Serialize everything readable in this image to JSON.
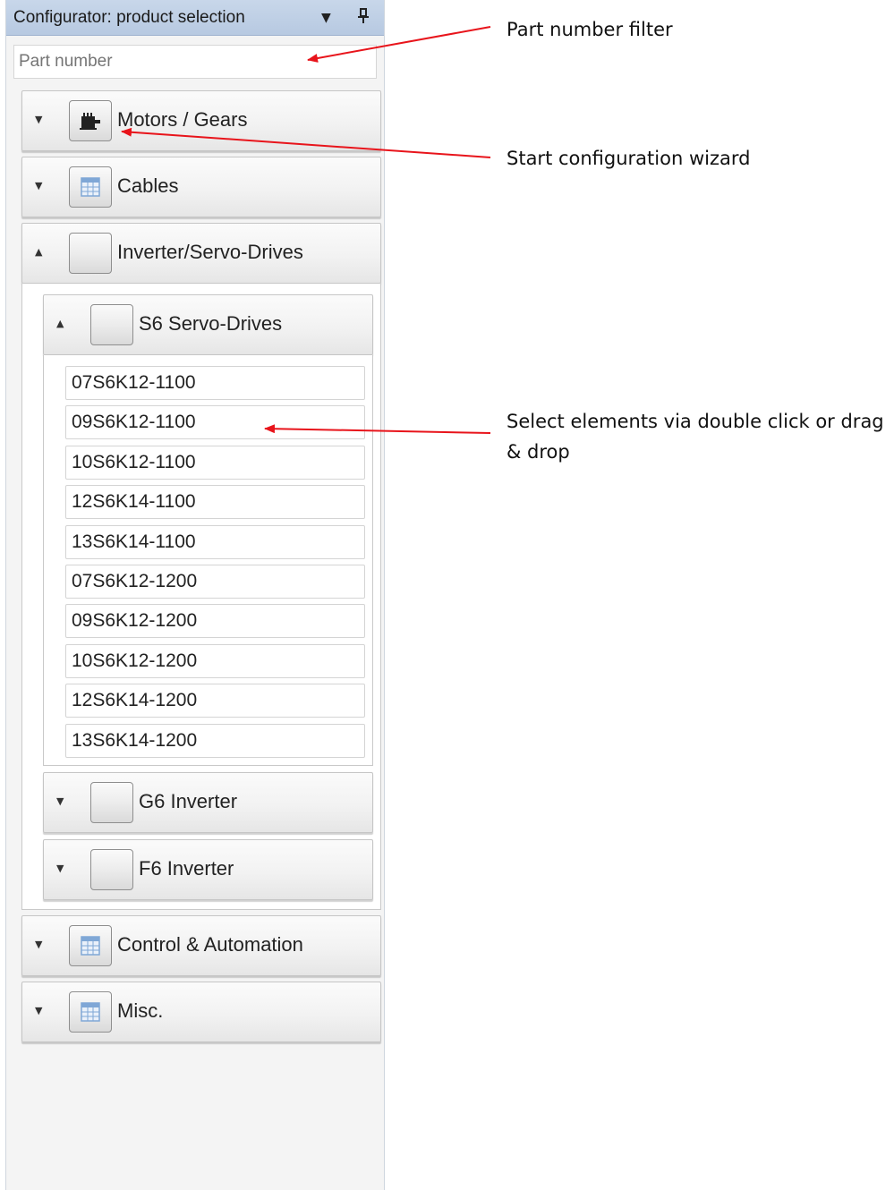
{
  "panel": {
    "title": "Configurator: product selection",
    "dropdown_icon": "dropdown-arrow-icon",
    "pin_icon": "pin-icon",
    "filter_placeholder": "Part number"
  },
  "tree": {
    "groups": [
      {
        "label": "Motors / Gears",
        "icon": "motor-icon",
        "expanded": false
      },
      {
        "label": "Cables",
        "icon": "table-icon",
        "expanded": false
      },
      {
        "label": "Inverter/Servo-Drives",
        "icon": "blank-icon",
        "expanded": true,
        "subgroups": [
          {
            "label": "S6 Servo-Drives",
            "icon": "blank-icon",
            "expanded": true,
            "items": [
              "07S6K12-1100",
              "09S6K12-1100",
              "10S6K12-1100",
              "12S6K14-1100",
              "13S6K14-1100",
              "07S6K12-1200",
              "09S6K12-1200",
              "10S6K12-1200",
              "12S6K14-1200",
              "13S6K14-1200"
            ]
          },
          {
            "label": "G6 Inverter",
            "icon": "blank-icon",
            "expanded": false
          },
          {
            "label": "F6 Inverter",
            "icon": "blank-icon",
            "expanded": false
          }
        ]
      },
      {
        "label": "Control & Automation",
        "icon": "table-icon",
        "expanded": false
      },
      {
        "label": "Misc.",
        "icon": "table-icon",
        "expanded": false
      }
    ]
  },
  "annotations": {
    "filter": "Part number filter",
    "wizard": "Start configuration wizard",
    "select": "Select elements via double click or drag & drop"
  },
  "colors": {
    "titlebar": "#bccde3",
    "arrow": "#e8141b",
    "table_icon_blue": "#7fa7d6"
  }
}
